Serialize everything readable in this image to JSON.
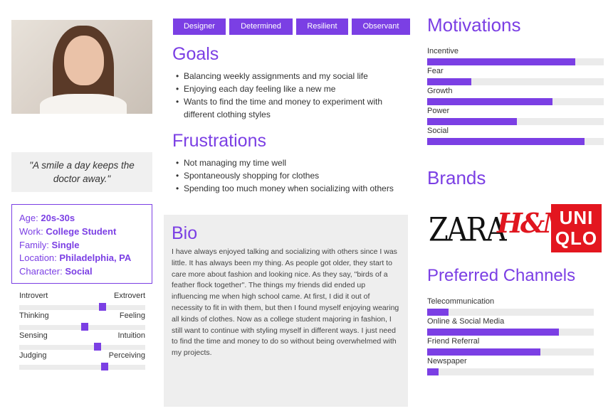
{
  "photo": {
    "alt": "portrait"
  },
  "quote": "\"A smile a day keeps the doctor away.\"",
  "info": {
    "age": {
      "label": "Age:",
      "value": "20s-30s"
    },
    "work": {
      "label": "Work:",
      "value": "College Student"
    },
    "family": {
      "label": "Family:",
      "value": "Single"
    },
    "location": {
      "label": "Location:",
      "value": "Philadelphia, PA"
    },
    "character": {
      "label": "Character:",
      "value": "Social"
    }
  },
  "traits": [
    {
      "left": "Introvert",
      "right": "Extrovert",
      "value": 0.66
    },
    {
      "left": "Thinking",
      "right": "Feeling",
      "value": 0.52
    },
    {
      "left": "Sensing",
      "right": "Intuition",
      "value": 0.62
    },
    {
      "left": "Judging",
      "right": "Perceiving",
      "value": 0.68
    }
  ],
  "tags": [
    "Designer",
    "Determined",
    "Resilient",
    "Observant"
  ],
  "goals": {
    "title": "Goals",
    "items": [
      "Balancing weekly assignments and my social life",
      "Enjoying each day feeling like a new me",
      "Wants to find the time and money to experiment with different clothing styles"
    ]
  },
  "frustrations": {
    "title": "Frustrations",
    "items": [
      "Not managing my time well",
      "Spontaneously shopping for clothes",
      "Spending too much money when socializing with others"
    ]
  },
  "bio": {
    "title": "Bio",
    "text": "I have always enjoyed talking and socializing with others since I was little. It has always been my thing. As people got older, they start to care more about fashion and looking nice. As they say, \"birds of a feather flock together\". The things my friends did ended up influencing me when high school came. At first, I did it out of necessity to fit in with them, but then I found myself enjoying wearing all kinds of clothes. Now as a college student majoring in fashion, I still want to continue with styling myself in different ways. I just need to find the time and money to do so without being overwhelmed with my projects."
  },
  "motivations": {
    "title": "Motivations",
    "items": [
      {
        "label": "Incentive",
        "value": 0.84
      },
      {
        "label": "Fear",
        "value": 0.25
      },
      {
        "label": "Growth",
        "value": 0.71
      },
      {
        "label": "Power",
        "value": 0.51
      },
      {
        "label": "Social",
        "value": 0.89
      }
    ]
  },
  "brands": {
    "title": "Brands",
    "zara": "ZARA",
    "hm": "H&M",
    "uniqlo_top": "UNI",
    "uniqlo_bottom": "QLO"
  },
  "channels": {
    "title": "Preferred Channels",
    "items": [
      {
        "label": "Telecommunication",
        "value": 0.13
      },
      {
        "label": "Online & Social Media",
        "value": 0.79
      },
      {
        "label": "Friend Referral",
        "value": 0.68
      },
      {
        "label": "Newspaper",
        "value": 0.07
      }
    ]
  },
  "colors": {
    "accent": "#7b3fe4",
    "hm_red": "#e0161f",
    "uniqlo_red": "#e3161f"
  }
}
